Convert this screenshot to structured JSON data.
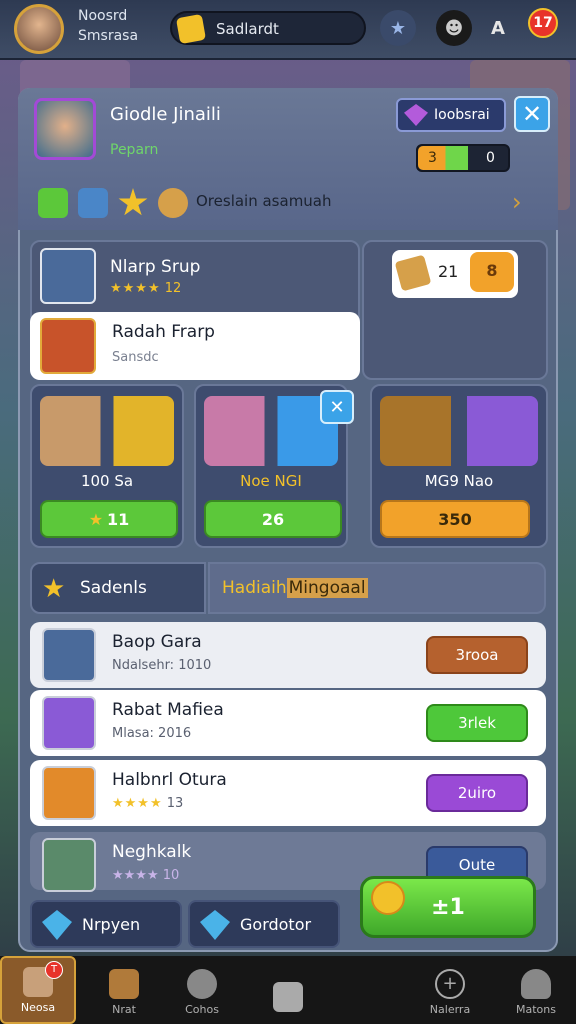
{
  "topbar": {
    "player_name": "Noosrd",
    "player_sub": "Smsrasa",
    "search_label": "Sadlardt",
    "notif_count": "17"
  },
  "profile": {
    "name": "Giodle Jinaili",
    "sub": "Peparn",
    "action_label": "Ioobsrai",
    "xp_left": "3",
    "xp_right": "0",
    "description": "Oreslain asamuah"
  },
  "items": {
    "item1_title": "Nlarp Srup",
    "item1_stat": "12",
    "item2_title": "Radah Frarp",
    "item2_sub": "Sansdc",
    "price_value": "21"
  },
  "shop": [
    {
      "label": "100 Sa",
      "buy": "11",
      "color": "#5cc83a"
    },
    {
      "label": "Noe NGI",
      "buy": "26",
      "color": "#5cc83a"
    },
    {
      "label": "MG9 Nao",
      "buy": "350",
      "color": "#f2a22a"
    }
  ],
  "tabs": {
    "tab1": "Sadenls",
    "tab2_pre": "Hadiaih ",
    "tab2_hl": "Mingoaal"
  },
  "list": [
    {
      "title": "Baop Gara",
      "sub": "Ndalsehr: 1010",
      "btn": "3rooa",
      "btn_color": "#b5612e",
      "bg": "#eceef3"
    },
    {
      "title": "Rabat Mafiea",
      "sub": "Mlasa: 2016",
      "btn": "3rlek",
      "btn_color": "#4ec83a",
      "bg": "#ffffff"
    },
    {
      "title": "Halbnrl Otura",
      "sub": "13",
      "btn": "2uiro",
      "btn_color": "#9a4ad6",
      "bg": "#ffffff"
    },
    {
      "title": "Neghkalk",
      "sub": "10",
      "btn": "Oute",
      "btn_color": "#3a5a9a",
      "bg": "#6e7a96"
    }
  ],
  "bottom": {
    "mini1": "Nrpyen",
    "mini2": "Gordotor",
    "big_btn": "±1"
  },
  "nav": [
    {
      "label": "Neosa",
      "icon": "home-icon"
    },
    {
      "label": "Nrat",
      "icon": "house-icon"
    },
    {
      "label": "Cohos",
      "icon": "search-icon"
    },
    {
      "label": "",
      "icon": "square-icon"
    },
    {
      "label": "Nalerra",
      "icon": "plus-circle-icon"
    },
    {
      "label": "Matons",
      "icon": "person-icon"
    }
  ]
}
